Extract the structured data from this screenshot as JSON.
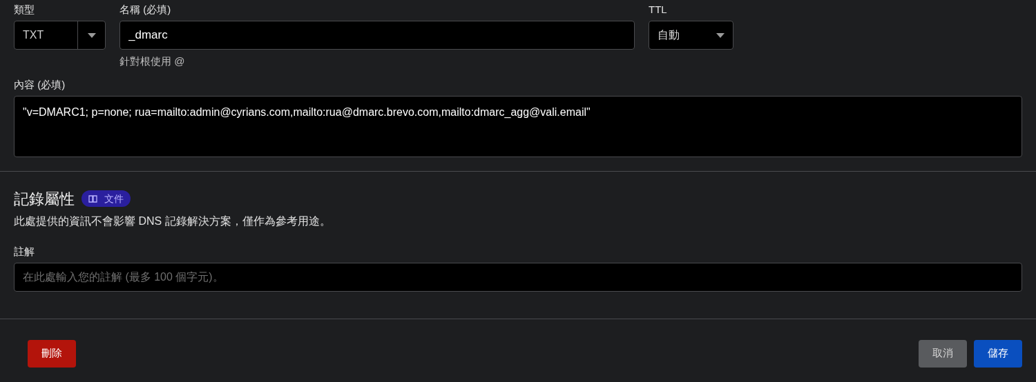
{
  "record": {
    "type": {
      "label": "類型",
      "value": "TXT"
    },
    "name": {
      "label": "名稱 (必填)",
      "value": "_dmarc",
      "hint": "針對根使用 @"
    },
    "ttl": {
      "label": "TTL",
      "value": "自動"
    },
    "content": {
      "label": "內容 (必填)",
      "value": "\"v=DMARC1; p=none; rua=mailto:admin@cyrians.com,mailto:rua@dmarc.brevo.com,mailto:dmarc_agg@vali.email\""
    }
  },
  "attributes": {
    "title": "記錄屬性",
    "badge": "文件",
    "description": "此處提供的資訊不會影響 DNS 記錄解決方案，僅作為參考用途。",
    "comment": {
      "label": "註解",
      "placeholder": "在此處輸入您的註解 (最多 100 個字元)。"
    }
  },
  "buttons": [
    {
      "kind": "danger",
      "label": "刪除"
    },
    {
      "kind": "secondary",
      "label": "取消"
    },
    {
      "kind": "primary",
      "label": "儲存"
    }
  ]
}
